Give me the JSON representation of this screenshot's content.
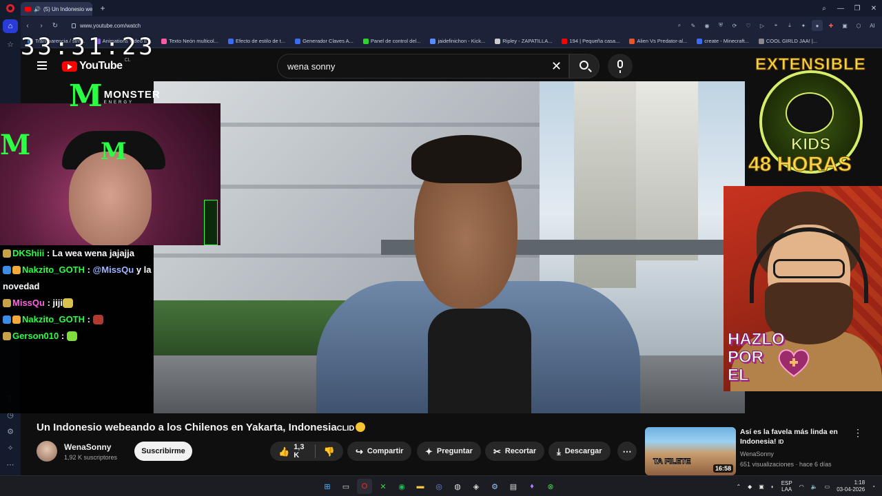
{
  "browser": {
    "tab_title": "(5) Un Indonesio web",
    "url": "www.youtube.com/watch",
    "bookmarks": [
      "Transparencia / stre...",
      "Animations Video E...",
      "Texto Neón multicol...",
      "Efecto de estilo de t...",
      "Generador Claves A...",
      "Panel de control del...",
      "jaidefinichon - Kick...",
      "Ripley - ZAPATILLA...",
      "194 | Pequeña casa...",
      "Alien Vs Predator-al...",
      "create - Minecraft...",
      "COOL GIRLD JAA! |..."
    ],
    "bookmark_colors": [
      "#3a8bd6",
      "#8b5cf6",
      "#ff5aa8",
      "#3c6df0",
      "#3c6df0",
      "#2bd62b",
      "#5b8cff",
      "#cccccc",
      "#ff0000",
      "#e8542a",
      "#3c6df0",
      "#888888"
    ]
  },
  "youtube": {
    "logo_word": "YouTube",
    "logo_region": "CL",
    "search_value": "wena sonny",
    "video_title": "Un Indonesio webeando a los Chilenos en Yakarta, Indonesia",
    "video_title_suffix": "CLID",
    "channel_name": "WenaSonny",
    "channel_subs": "1,92 K suscriptores",
    "subscribe_label": "Suscribirme",
    "likes": "1,3 K",
    "share_label": "Compartir",
    "ask_label": "Preguntar",
    "clip_label": "Recortar",
    "download_label": "Descargar",
    "recommended": {
      "title": "Así es la favela más linda en Indonesia!",
      "title_suffix": "ID",
      "channel": "WenaSonny",
      "meta": "651 visualizaciones · hace 6 días",
      "thumb_text": "TA FILETE",
      "duration": "16:58"
    }
  },
  "overlay": {
    "timer": "33:31:23",
    "monster_brand": "MONSTER",
    "monster_sub": "ENERGY",
    "promo_top": "EXTENSIBLE",
    "promo_kids": "KIDS",
    "promo_hours": "48 HORAS",
    "promo_cta_1": "HAZLO",
    "promo_cta_2": "POR",
    "promo_cta_3": "EL",
    "chat": [
      {
        "user": "DKShiii",
        "text": " : La wea wena jajajja"
      },
      {
        "user": "Nakzito_GOTH",
        "text": " : ",
        "mention": "@MissQu",
        "rest": " y la novedad"
      },
      {
        "user": "MissQu",
        "text": " : jiji"
      },
      {
        "user": "Nakzito_GOTH",
        "text": " : "
      },
      {
        "user": "Gerson010",
        "text": " : "
      }
    ]
  },
  "taskbar": {
    "lang_1": "ESP",
    "lang_2": "LAA",
    "time": "1:18",
    "date": "03-04-2026"
  },
  "colors": {
    "accent_red": "#ff0000",
    "chat_user_green": "#2bff43",
    "chat_user_pink": "#ff66dd",
    "monster_green": "#2bff43"
  }
}
